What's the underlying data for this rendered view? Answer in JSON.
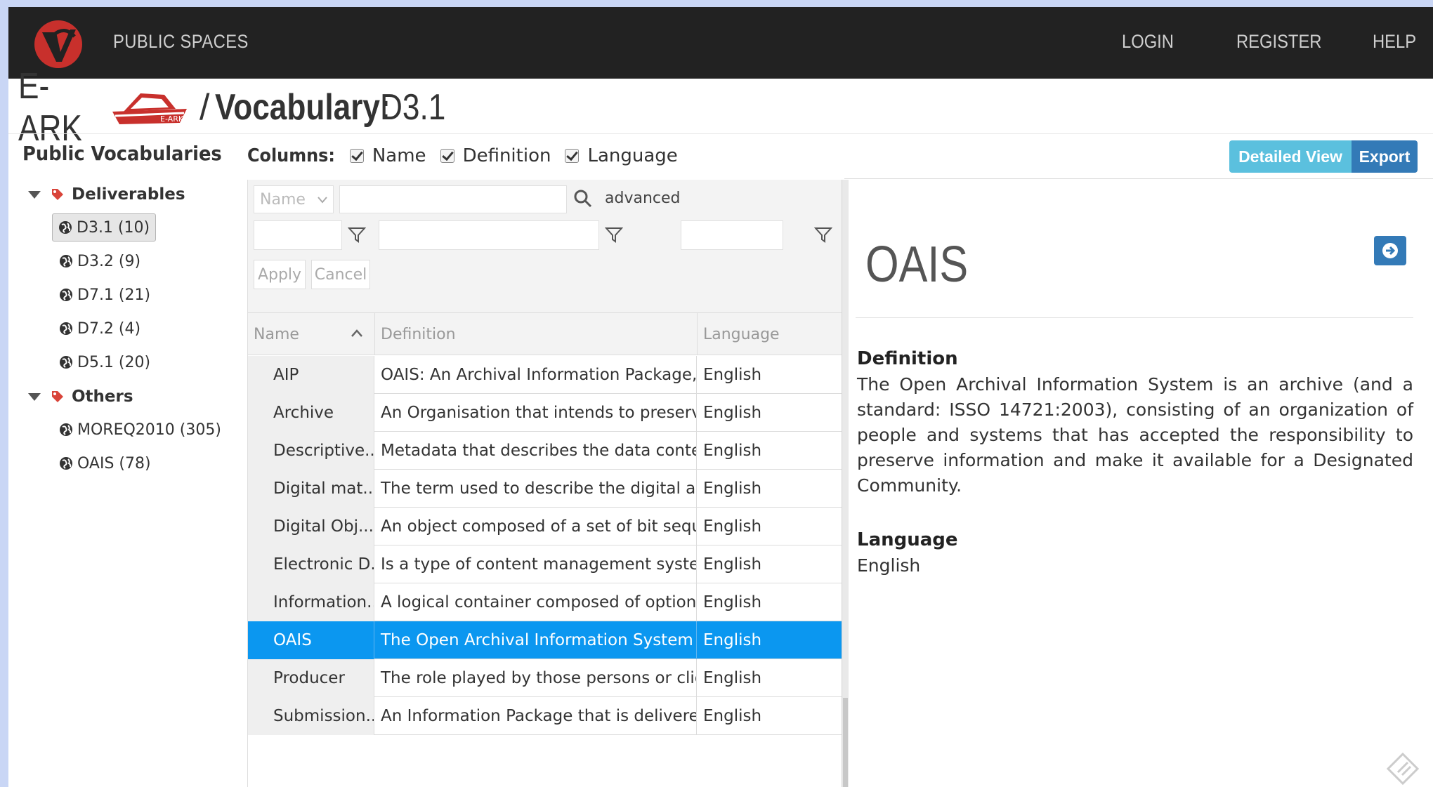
{
  "nav": {
    "logo_icon": "v-logo-icon",
    "public_spaces": "PUBLIC SPACES",
    "login": "LOGIN",
    "register": "REGISTER",
    "help": "HELP"
  },
  "title": {
    "project": "E-ARK",
    "project_logo_icon": "ark-boat-logo",
    "separator": "/",
    "vocabulary_label": "Vocabulary:",
    "vocabulary_name": "D3.1"
  },
  "sidebar": {
    "title": "Public Vocabularies",
    "groups": [
      {
        "label": "Deliverables",
        "items": [
          {
            "label": "D3.1 (10)",
            "active": true
          },
          {
            "label": "D3.2 (9)"
          },
          {
            "label": "D7.1 (21)"
          },
          {
            "label": "D7.2 (4)"
          },
          {
            "label": "D5.1 (20)"
          }
        ]
      },
      {
        "label": "Others",
        "items": [
          {
            "label": "MOREQ2010 (305)"
          },
          {
            "label": "OAIS (78)"
          }
        ]
      }
    ]
  },
  "columns": {
    "label": "Columns:",
    "options": [
      {
        "label": "Name",
        "checked": true
      },
      {
        "label": "Definition",
        "checked": true
      },
      {
        "label": "Language",
        "checked": true
      }
    ]
  },
  "view_buttons": {
    "detailed": "Detailed View",
    "export": "Export"
  },
  "filters": {
    "field_select": "Name",
    "search_value": "",
    "advanced": "advanced",
    "apply": "Apply",
    "cancel": "Cancel"
  },
  "table": {
    "headers": [
      "Name",
      "Definition",
      "Language"
    ],
    "sort_column": "Name",
    "sort_direction": "ascending",
    "rows": [
      {
        "name": "AIP",
        "definition": "OAIS: An Archival Information Package, ...",
        "language": "English"
      },
      {
        "name": "Archive",
        "definition": "An Organisation that intends to preserv...",
        "language": "English"
      },
      {
        "name": "Descriptive...",
        "definition": "Metadata that describes the data conte...",
        "language": "English"
      },
      {
        "name": "Digital mat...",
        "definition": "The term used to describe the digital as...",
        "language": "English"
      },
      {
        "name": "Digital Obj...",
        "definition": "An object composed of a set of bit sequ...",
        "language": "English"
      },
      {
        "name": "Electronic D...",
        "definition": "Is a type of content management syste...",
        "language": "English"
      },
      {
        "name": "Information...",
        "definition": "A logical container composed of option...",
        "language": "English"
      },
      {
        "name": "OAIS",
        "definition": "The Open Archival Information System i...",
        "language": "English",
        "selected": true
      },
      {
        "name": "Producer",
        "definition": "The role played by those persons or clie...",
        "language": "English"
      },
      {
        "name": "Submission...",
        "definition": "An Information Package that is delivere...",
        "language": "English"
      }
    ]
  },
  "detail": {
    "title": "OAIS",
    "definition_label": "Definition",
    "definition_text": "The Open Archival Information System is an archive (and a standard: ISSO 14721:2003), consisting of an organization of people and systems that has accepted the responsibility to preserve information and make it available for a Designated Community.",
    "language_label": "Language",
    "language_value": "English"
  },
  "colors": {
    "navbar": "#222222",
    "selected_row": "#0b97f0",
    "btn_detailed": "#5bc0de",
    "btn_export": "#337ab7",
    "tag_red": "#d9443a"
  }
}
